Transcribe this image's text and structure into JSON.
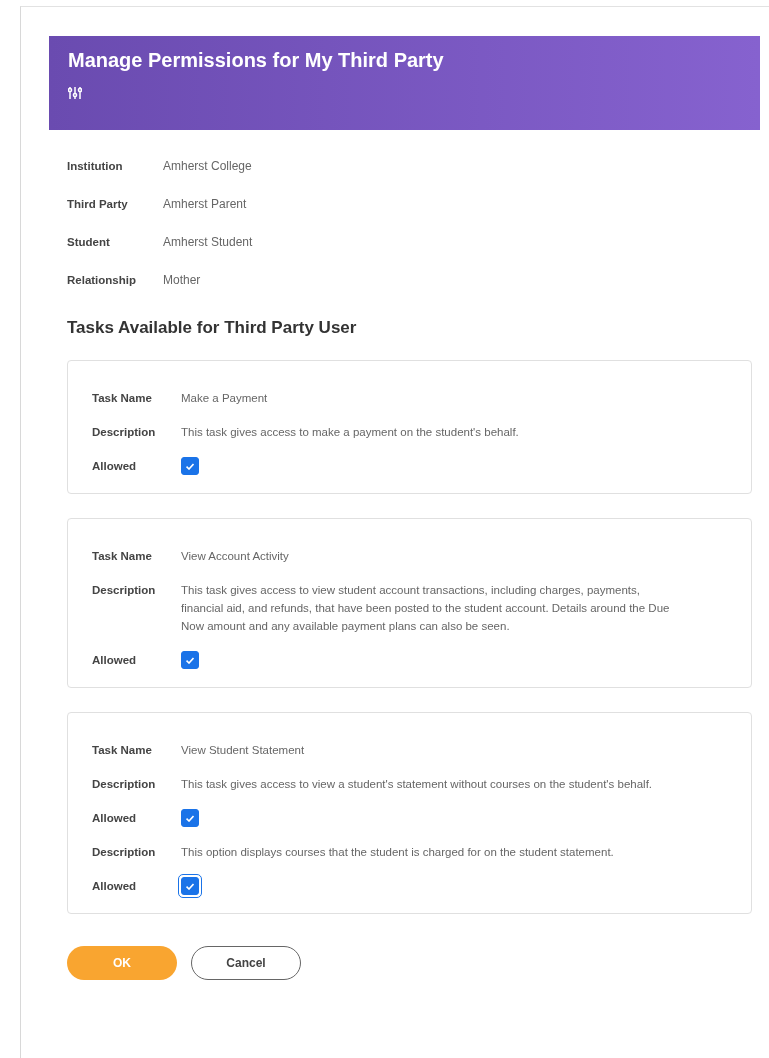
{
  "header": {
    "title": "Manage Permissions for My Third Party"
  },
  "details": [
    {
      "label": "Institution",
      "value": "Amherst College"
    },
    {
      "label": "Third Party",
      "value": "Amherst Parent"
    },
    {
      "label": "Student",
      "value": "Amherst Student"
    },
    {
      "label": "Relationship",
      "value": "Mother"
    }
  ],
  "tasks_heading": "Tasks Available for Third Party User",
  "tasks": [
    {
      "rows": [
        {
          "kind": "text",
          "label": "Task Name",
          "value": "Make a Payment"
        },
        {
          "kind": "text",
          "label": "Description",
          "value": "This task gives access to make a payment on the student's behalf."
        },
        {
          "kind": "checkbox",
          "label": "Allowed",
          "checked": true,
          "focused": false
        }
      ]
    },
    {
      "rows": [
        {
          "kind": "text",
          "label": "Task Name",
          "value": "View Account Activity"
        },
        {
          "kind": "text",
          "label": "Description",
          "value": "This task gives access to view student account transactions, including charges, payments, financial aid, and refunds, that have been posted to the student account. Details around the Due Now amount and any available payment plans can also be seen."
        },
        {
          "kind": "checkbox",
          "label": "Allowed",
          "checked": true,
          "focused": false
        }
      ]
    },
    {
      "rows": [
        {
          "kind": "text",
          "label": "Task Name",
          "value": "View Student Statement"
        },
        {
          "kind": "text",
          "label": "Description",
          "value": "This task gives access to view a student's statement without courses on the student's behalf."
        },
        {
          "kind": "checkbox",
          "label": "Allowed",
          "checked": true,
          "focused": false
        },
        {
          "kind": "text",
          "label": "Description",
          "value": "This option displays courses that the student is charged for on the student statement."
        },
        {
          "kind": "checkbox",
          "label": "Allowed",
          "checked": true,
          "focused": true
        }
      ]
    }
  ],
  "buttons": [
    {
      "label": "OK",
      "kind": "primary"
    },
    {
      "label": "Cancel",
      "kind": "secondary"
    }
  ]
}
